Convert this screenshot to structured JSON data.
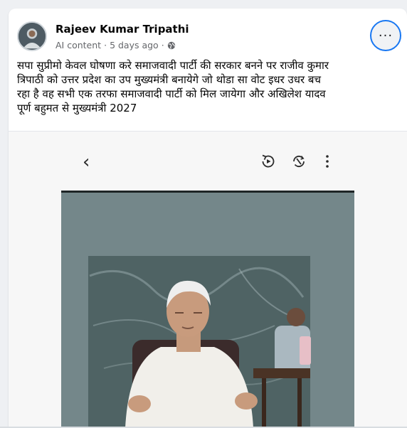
{
  "post": {
    "author": "Rajeev Kumar Tripathi",
    "meta_label": "AI content",
    "meta_time": "5 days ago",
    "meta_separator": "·",
    "more_label": "···",
    "text": "सपा सुप्रीमो केवल घोषणा करे समाजवादी पार्टी की सरकार बनने पर राजीव कुमार\nत्रिपाठी को उत्तर प्रदेश का उप मुख्यमंत्री बनायेगे जो थोडा सा वोट इधर उधर बच\nरहा है वह सभी एक तरफा समाजवादी पार्टी को मिल जायेगा और अखिलेश यादव\nपूर्ण बहुमत से मुख्यमंत्री 2027"
  },
  "media_toolbar": {
    "back_symbol": "‹",
    "icons": [
      "rotate-play-icon",
      "sync-off-icon",
      "kebab-menu-icon"
    ]
  },
  "colors": {
    "accent": "#1877f2",
    "meta": "#65676b",
    "card": "#ffffff",
    "page": "#eef0f3"
  }
}
